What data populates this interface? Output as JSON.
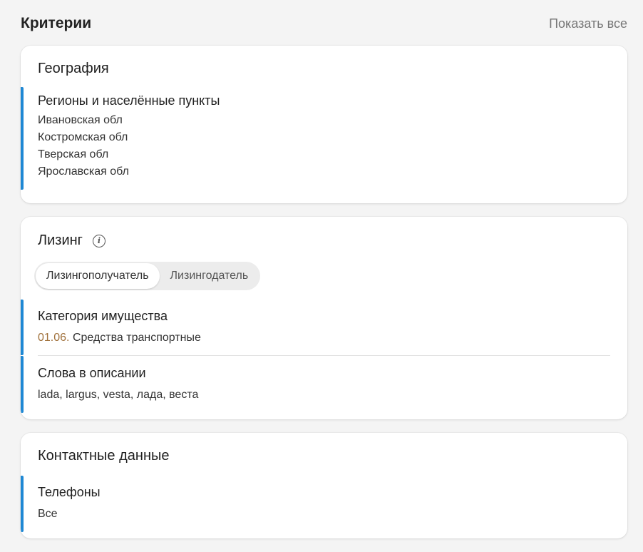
{
  "header": {
    "title": "Критерии",
    "show_all": "Показать все"
  },
  "geography": {
    "title": "География",
    "regions": {
      "title": "Регионы и населённые пункты",
      "items": [
        "Ивановская обл",
        "Костромская обл",
        "Тверская обл",
        "Ярославская обл"
      ]
    }
  },
  "leasing": {
    "title": "Лизинг",
    "info_icon": "info-icon",
    "toggle": {
      "options": [
        "Лизингополучатель",
        "Лизингодатель"
      ],
      "selected": "Лизингополучатель"
    },
    "category": {
      "title": "Категория имущества",
      "code": "01.06.",
      "name": "Средства транспортные"
    },
    "keywords": {
      "title": "Слова в описании",
      "value": "lada, largus, vesta, лада, веста"
    }
  },
  "contacts": {
    "title": "Контактные данные",
    "phones": {
      "title": "Телефоны",
      "value": "Все"
    }
  },
  "colors": {
    "accent_bar": "#1e88d4",
    "code_color": "#a0703a",
    "background": "#f4f4f4"
  }
}
